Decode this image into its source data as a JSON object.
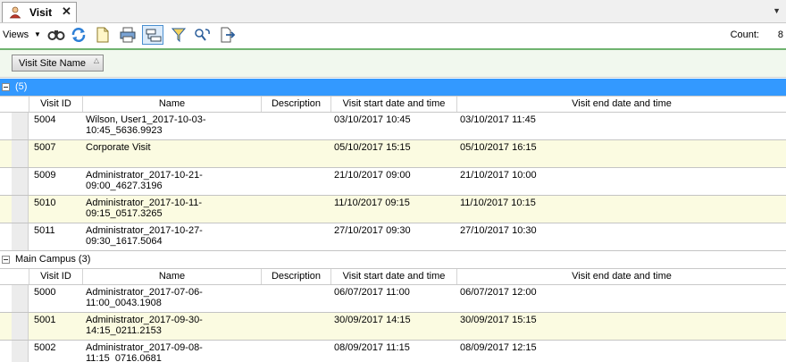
{
  "tab": {
    "title": "Visit",
    "close": "✕",
    "icon": "user-icon"
  },
  "toolbar": {
    "views_label": "Views",
    "count_label": "Count:",
    "count_value": "8",
    "buttons": [
      "binoculars-icon",
      "refresh-icon",
      "new-document-icon",
      "print-icon",
      "group-by-icon",
      "filter-icon",
      "find-replace-icon",
      "export-icon"
    ]
  },
  "group_panel": {
    "chip_label": "Visit Site Name"
  },
  "columns": [
    "Visit ID",
    "Name",
    "Description",
    "Visit start date and time",
    "Visit end date and time"
  ],
  "groups": [
    {
      "label": "(5)",
      "selected": true,
      "rows": [
        {
          "id": "5004",
          "name1": "Wilson, User1_2017-10-03-",
          "name2": "10:45_5636.9923",
          "desc": "",
          "start": "03/10/2017 10:45",
          "end": "03/10/2017 11:45"
        },
        {
          "id": "5007",
          "name1": "Corporate Visit",
          "name2": "",
          "desc": "",
          "start": "05/10/2017 15:15",
          "end": "05/10/2017 16:15"
        },
        {
          "id": "5009",
          "name1": "Administrator_2017-10-21-",
          "name2": "09:00_4627.3196",
          "desc": "",
          "start": "21/10/2017 09:00",
          "end": "21/10/2017 10:00"
        },
        {
          "id": "5010",
          "name1": "Administrator_2017-10-11-",
          "name2": "09:15_0517.3265",
          "desc": "",
          "start": "11/10/2017 09:15",
          "end": "11/10/2017 10:15"
        },
        {
          "id": "5011",
          "name1": "Administrator_2017-10-27-",
          "name2": "09:30_1617.5064",
          "desc": "",
          "start": "27/10/2017 09:30",
          "end": "27/10/2017 10:30"
        }
      ]
    },
    {
      "label": "Main Campus (3)",
      "selected": false,
      "rows": [
        {
          "id": "5000",
          "name1": "Administrator_2017-07-06-",
          "name2": "11:00_0043.1908",
          "desc": "",
          "start": "06/07/2017 11:00",
          "end": "06/07/2017 12:00"
        },
        {
          "id": "5001",
          "name1": "Administrator_2017-09-30-",
          "name2": "14:15_0211.2153",
          "desc": "",
          "start": "30/09/2017 14:15",
          "end": "30/09/2017 15:15"
        },
        {
          "id": "5002",
          "name1": "Administrator_2017-09-08-",
          "name2": "11:15_0716.0681",
          "desc": "",
          "start": "08/09/2017 11:15",
          "end": "08/09/2017 12:15"
        }
      ]
    }
  ]
}
